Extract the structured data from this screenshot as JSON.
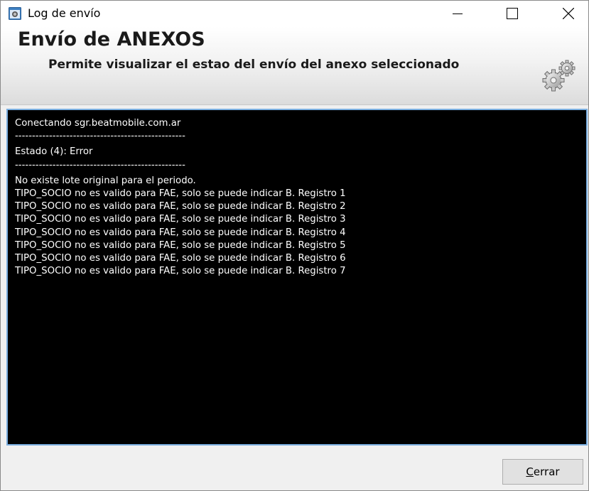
{
  "window": {
    "title": "Log de envío",
    "icons": {
      "app": "app-window-icon",
      "minimize": "minimize-icon",
      "maximize": "maximize-icon",
      "close": "close-icon"
    }
  },
  "header": {
    "title": "Envío de ANEXOS",
    "subtitle": "Permite visualizar el estao del envío del anexo seleccionado",
    "icon": "gears-icon"
  },
  "log": {
    "lines": [
      "Conectando sgr.beatmobile.com.ar",
      "--------------------------------------------------",
      "Estado (4): Error",
      "--------------------------------------------------",
      "No existe lote original para el periodo.",
      "TIPO_SOCIO no es valido para FAE, solo se puede indicar B. Registro 1",
      "TIPO_SOCIO no es valido para FAE, solo se puede indicar B. Registro 2",
      "TIPO_SOCIO no es valido para FAE, solo se puede indicar B. Registro 3",
      "TIPO_SOCIO no es valido para FAE, solo se puede indicar B. Registro 4",
      "TIPO_SOCIO no es valido para FAE, solo se puede indicar B. Registro 5",
      "TIPO_SOCIO no es valido para FAE, solo se puede indicar B. Registro 6",
      "TIPO_SOCIO no es valido para FAE, solo se puede indicar B. Registro 7"
    ]
  },
  "footer": {
    "close_button": {
      "mnemonic": "C",
      "rest": "errar"
    }
  },
  "colors": {
    "log_background": "#000000",
    "log_text": "#ffffff",
    "log_border": "#7aaee0",
    "window_background": "#f0f0f0"
  }
}
